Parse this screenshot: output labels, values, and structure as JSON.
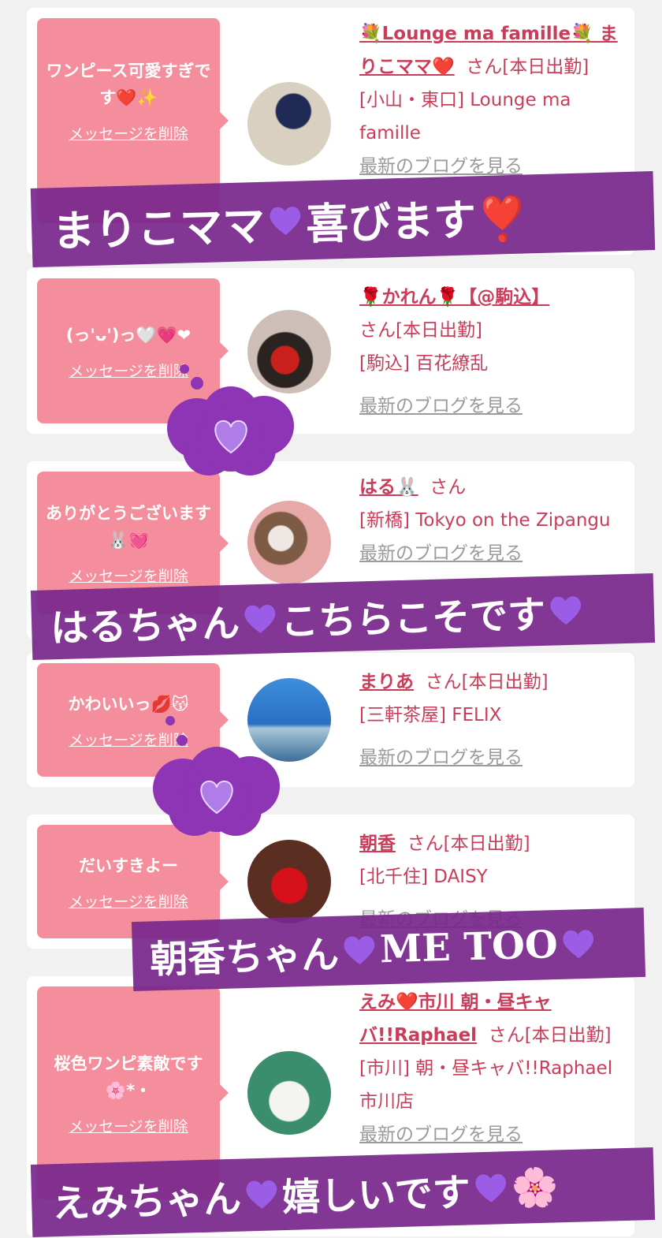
{
  "colors": {
    "bubble": "#f58e9c",
    "name": "#c93d5a",
    "banner": "#7a2a8e",
    "heart": "#9b5de5",
    "cloud": "#8d35b5"
  },
  "common": {
    "delete_label": "メッセージを削除",
    "blog_label": "最新のブログを見る",
    "san": "さん"
  },
  "cards": [
    {
      "message": "ワンピース可愛すぎです❤️✨",
      "name": "💐Lounge ma famille💐 まりこママ❤️",
      "status": "[本日出勤]",
      "area": "[小山・東口] Lounge ma famille"
    },
    {
      "message": "(っ'ᴗ')っ🤍💗❤",
      "name": "🌹かれん🌹【@駒込】",
      "status": "[本日出勤]",
      "area": "[駒込] 百花繚乱"
    },
    {
      "message": "ありがとうございます🐰💓",
      "name": "はる🐰",
      "status": "",
      "area": "[新橋] Tokyo on the Zipangu"
    },
    {
      "message": "かわいいっ💋😽",
      "name": "まりあ",
      "status": "[本日出勤]",
      "area": "[三軒茶屋] FELIX"
    },
    {
      "message": "だいすきよー",
      "name": "朝香",
      "status": "[本日出勤]",
      "area": "[北千住] DAISY"
    },
    {
      "message": "桜色ワンピ素敵です🌸*・",
      "name": "えみ❤️市川 朝・昼キャバ!!Raphael",
      "status": "[本日出勤]",
      "area": "[市川] 朝・昼キャバ!!Raphael 市川店"
    }
  ],
  "banners": [
    {
      "before": "まりこママ",
      "after": "喜びます❣️"
    },
    {
      "before": "はるちゃん",
      "after": "こちらこそです"
    },
    {
      "before": "朝香ちゃん",
      "after": "ME TOO"
    },
    {
      "before": "えみちゃん",
      "after": "嬉しいです"
    }
  ],
  "banner_extras": {
    "blossom": "🌸"
  },
  "icons": {
    "heart": "purple-heart-icon",
    "cloud": "purple-cloud-heart-icon"
  }
}
